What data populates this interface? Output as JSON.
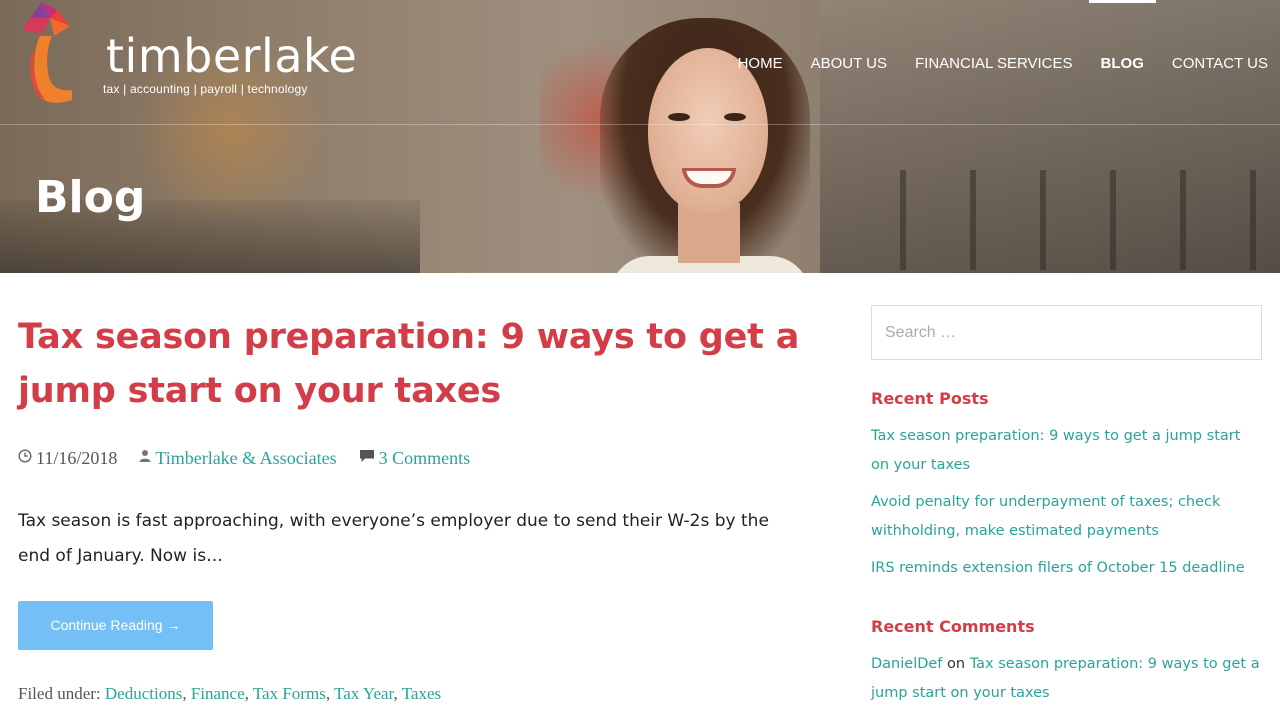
{
  "brand": {
    "name": "timberlake",
    "tagline": "tax | accounting | payroll | technology"
  },
  "nav": {
    "items": [
      {
        "label": "HOME",
        "active": false
      },
      {
        "label": "ABOUT US",
        "active": false
      },
      {
        "label": "FINANCIAL SERVICES",
        "active": false
      },
      {
        "label": "BLOG",
        "active": true
      },
      {
        "label": "CONTACT US",
        "active": false
      }
    ]
  },
  "hero": {
    "title": "Blog"
  },
  "post": {
    "title": "Tax season preparation: 9 ways to get a jump start on your taxes",
    "date": "11/16/2018",
    "author": "Timberlake & Associates",
    "comments": "3 Comments",
    "excerpt": "Tax season is fast approaching, with everyone’s employer due to send their W-2s by the end of January. Now is…",
    "button": "Continue Reading →",
    "filed_label": "Filed under:",
    "categories": [
      "Deductions",
      "Finance",
      "Tax Forms",
      "Tax Year",
      "Taxes"
    ],
    "separator": ", "
  },
  "sidebar": {
    "search_placeholder": "Search …",
    "recent_posts_title": "Recent Posts",
    "recent_posts": [
      "Tax season preparation: 9 ways to get a jump start on your taxes",
      "Avoid penalty for underpayment of taxes; check withholding, make estimated payments",
      "IRS reminds extension filers of October 15 deadline"
    ],
    "recent_comments_title": "Recent Comments",
    "recent_comment": {
      "author": "DanielDef",
      "joiner": " on ",
      "post": "Tax season preparation: 9 ways to get a jump start on your taxes"
    }
  },
  "icons": {
    "date": "clock-icon",
    "author": "user-icon",
    "comments": "comment-icon"
  },
  "colors": {
    "accent_red": "#d33d48",
    "link_teal": "#2aa39a",
    "button_blue": "#74bff5"
  }
}
